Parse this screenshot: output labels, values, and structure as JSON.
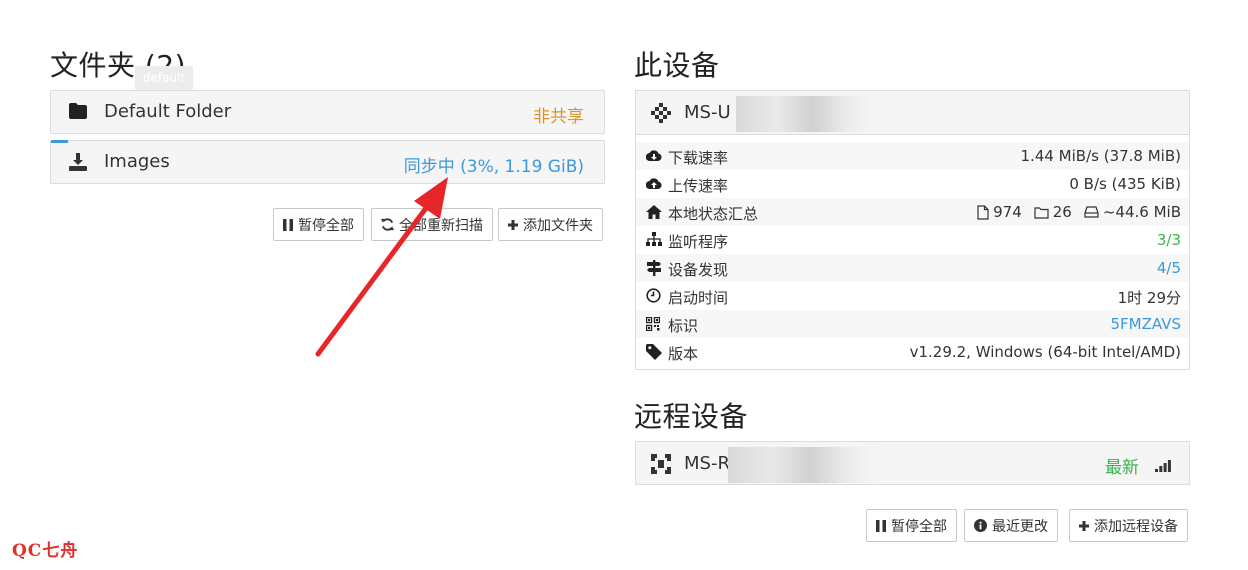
{
  "folders": {
    "title": "文件夹 (2)",
    "tooltip": "default",
    "items": [
      {
        "label": "Default Folder",
        "status": "非共享",
        "status_color": "#d9972b",
        "icon": "folder-icon"
      },
      {
        "label": "Images",
        "status": "同步中 (3%, 1.19 GiB)",
        "status_color": "#3a9ad9",
        "icon": "download-icon",
        "progress_percent": 3
      }
    ],
    "buttons": {
      "pause_all": "暂停全部",
      "rescan_all": "全部重新扫描",
      "add_folder": "添加文件夹"
    }
  },
  "this_device": {
    "title": "此设备",
    "name": "MS-U",
    "info": [
      {
        "icon": "cloud-download-icon",
        "key": "下载速率",
        "value": "1.44 MiB/s (37.8 MiB)"
      },
      {
        "icon": "cloud-upload-icon",
        "key": "上传速率",
        "value": "0 B/s (435 KiB)"
      },
      {
        "icon": "home-icon",
        "key": "本地状态汇总",
        "files": "974",
        "dirs": "26",
        "size": "~44.6 MiB"
      },
      {
        "icon": "sitemap-icon",
        "key": "监听程序",
        "value": "3/3",
        "color": "#3bb34a"
      },
      {
        "icon": "signpost-icon",
        "key": "设备发现",
        "value": "4/5",
        "color": "#3a9ad9"
      },
      {
        "icon": "clock-icon",
        "key": "启动时间",
        "value": "1时 29分"
      },
      {
        "icon": "qrcode-icon",
        "key": "标识",
        "value": "5FMZAVS",
        "color": "#3a9ad9"
      },
      {
        "icon": "tag-icon",
        "key": "版本",
        "value": "v1.29.2, Windows (64-bit Intel/AMD)"
      }
    ]
  },
  "remote_devices": {
    "title": "远程设备",
    "items": [
      {
        "name": "MS-R",
        "status": "最新",
        "status_color": "#3bb34a"
      }
    ],
    "buttons": {
      "pause_all": "暂停全部",
      "recent_changes": "最近更改",
      "add_remote": "添加远程设备"
    }
  },
  "watermark": "QC七舟"
}
